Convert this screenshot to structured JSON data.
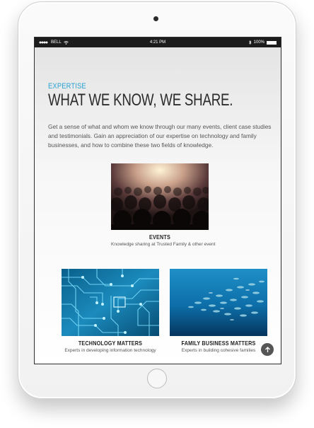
{
  "status_bar": {
    "carrier": "BELL",
    "time": "4:21 PM",
    "battery": "100%"
  },
  "page": {
    "eyebrow": "EXPERTISE",
    "headline": "WHAT WE KNOW, WE SHARE.",
    "intro": "Get a sense of what and whom we know through our many events, client case studies and testimonials. Gain an appreciation of our expertise on technology and family businesses, and how to combine these two fields of knowledge."
  },
  "cards": {
    "events": {
      "title": "EVENTS",
      "description": "Knowledge sharing at Trusted Family & other event"
    },
    "technology": {
      "title": "TECHNOLOGY MATTERS",
      "description": "Experts in developing information technology"
    },
    "family_business": {
      "title": "FAMILY BUSINESS MATTERS",
      "description": "Experts in building cohesive families"
    }
  },
  "colors": {
    "accent": "#2aa1d3",
    "heading": "#2b2b2b",
    "status_bar": "#1c1c1c"
  },
  "icons": {
    "scroll_top": "arrow-up-icon"
  }
}
